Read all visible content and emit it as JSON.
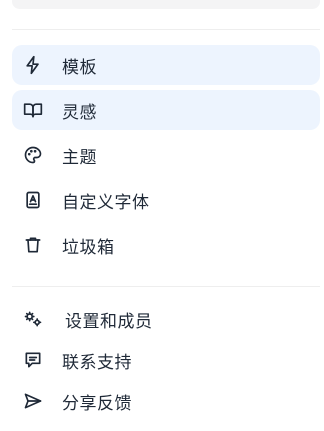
{
  "menu": {
    "primary": [
      {
        "label": "模板",
        "icon": "lightning-icon",
        "active": true
      },
      {
        "label": "灵感",
        "icon": "book-open-icon",
        "active": true
      },
      {
        "label": "主题",
        "icon": "palette-icon",
        "active": false
      },
      {
        "label": "自定义字体",
        "icon": "font-book-icon",
        "active": false
      },
      {
        "label": "垃圾箱",
        "icon": "trash-icon",
        "active": false
      }
    ],
    "secondary": [
      {
        "label": "设置和成员",
        "icon": "gears-icon"
      },
      {
        "label": "联系支持",
        "icon": "message-icon"
      },
      {
        "label": "分享反馈",
        "icon": "send-icon"
      }
    ]
  },
  "colors": {
    "active_background": "#edf4fe",
    "text": "#1f2937",
    "divider": "#eeeeee"
  }
}
